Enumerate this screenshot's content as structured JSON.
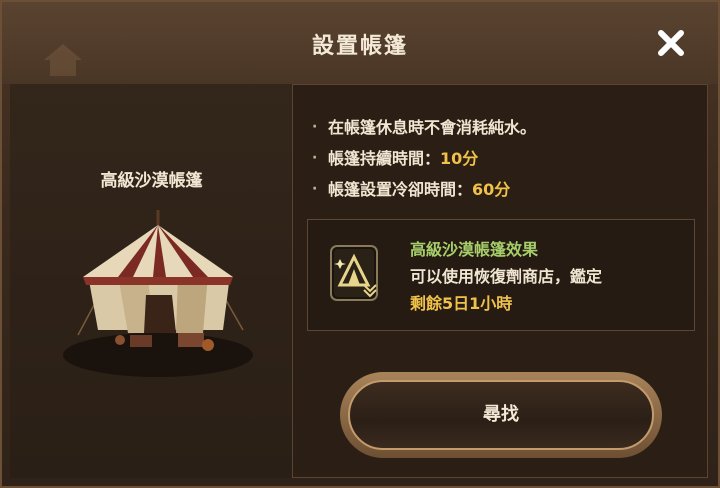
{
  "dialog": {
    "title": "設置帳篷",
    "close_icon": "close-icon"
  },
  "tent": {
    "name": "高級沙漠帳篷",
    "image_icon": "desert-tent-image"
  },
  "info": {
    "bullet": "·",
    "line1": "在帳篷休息時不會消耗純水。",
    "line2_label": "帳篷持續時間：",
    "line2_value": "10分",
    "line3_label": "帳篷設置冷卻時間：",
    "line3_value": "60分"
  },
  "effect": {
    "icon": "tent-buff-icon",
    "title": "高級沙漠帳篷效果",
    "description": "可以使用恢復劑商店，鑑定",
    "remaining": "剩餘5日1小時"
  },
  "actions": {
    "find_label": "尋找"
  },
  "colors": {
    "highlight": "#f1c24a",
    "effect_title": "#a6cf6b",
    "text": "#f1e6d2"
  }
}
